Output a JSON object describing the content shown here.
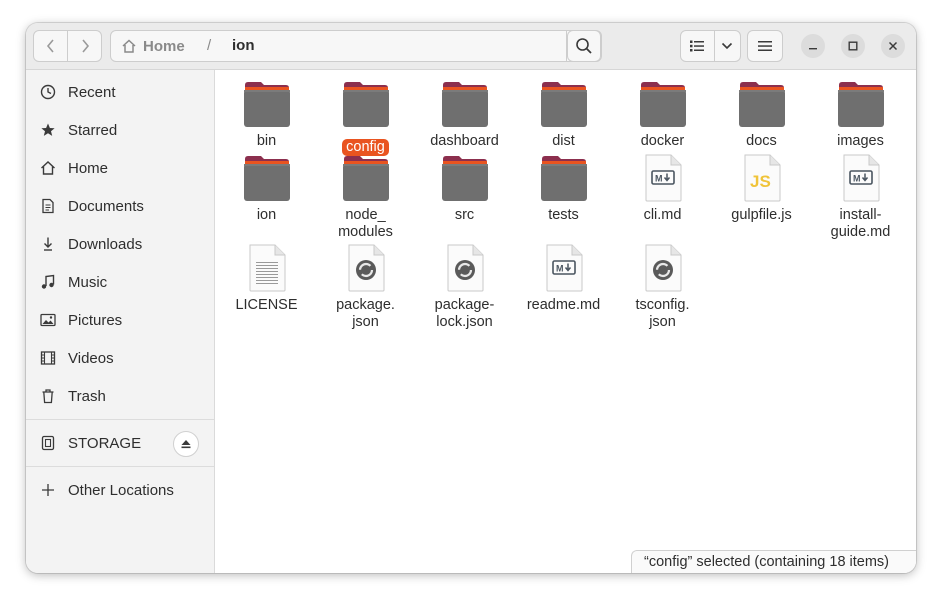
{
  "pathbar": {
    "home_label": "Home",
    "separator": "/",
    "current": "ion"
  },
  "sidebar": {
    "items": [
      {
        "label": "Recent",
        "icon": "clock-icon"
      },
      {
        "label": "Starred",
        "icon": "star-icon"
      },
      {
        "label": "Home",
        "icon": "home-icon"
      },
      {
        "label": "Documents",
        "icon": "document-icon"
      },
      {
        "label": "Downloads",
        "icon": "download-icon"
      },
      {
        "label": "Music",
        "icon": "music-icon"
      },
      {
        "label": "Pictures",
        "icon": "picture-icon"
      },
      {
        "label": "Videos",
        "icon": "video-icon"
      },
      {
        "label": "Trash",
        "icon": "trash-icon"
      }
    ],
    "storage": {
      "label": "STORAGE",
      "icon": "drive-icon"
    },
    "other": {
      "label": "Other Locations",
      "icon": "plus-icon"
    }
  },
  "files": [
    {
      "name": "bin",
      "type": "folder"
    },
    {
      "name": "config",
      "type": "folder",
      "selected": true
    },
    {
      "name": "dashboard",
      "type": "folder"
    },
    {
      "name": "dist",
      "type": "folder"
    },
    {
      "name": "docker",
      "type": "folder"
    },
    {
      "name": "docs",
      "type": "folder"
    },
    {
      "name": "images",
      "type": "folder"
    },
    {
      "name": "ion",
      "type": "folder"
    },
    {
      "name": "node_\nmodules",
      "type": "folder"
    },
    {
      "name": "src",
      "type": "folder"
    },
    {
      "name": "tests",
      "type": "folder"
    },
    {
      "name": "cli.md",
      "type": "markdown"
    },
    {
      "name": "gulpfile.js",
      "type": "javascript"
    },
    {
      "name": "install-\nguide.md",
      "type": "markdown"
    },
    {
      "name": "LICENSE",
      "type": "text"
    },
    {
      "name": "package.\njson",
      "type": "json"
    },
    {
      "name": "package-\nlock.json",
      "type": "json"
    },
    {
      "name": "readme.md",
      "type": "markdown"
    },
    {
      "name": "tsconfig.\njson",
      "type": "json"
    }
  ],
  "status": {
    "text": "“config” selected  (containing 18 items)"
  },
  "colors": {
    "accent": "#e95420",
    "folder_body": "#6f6f6f",
    "folder_tab": "#8c2f4e",
    "folder_stripe": "#e95420",
    "js_badge": "#f0c43a"
  }
}
